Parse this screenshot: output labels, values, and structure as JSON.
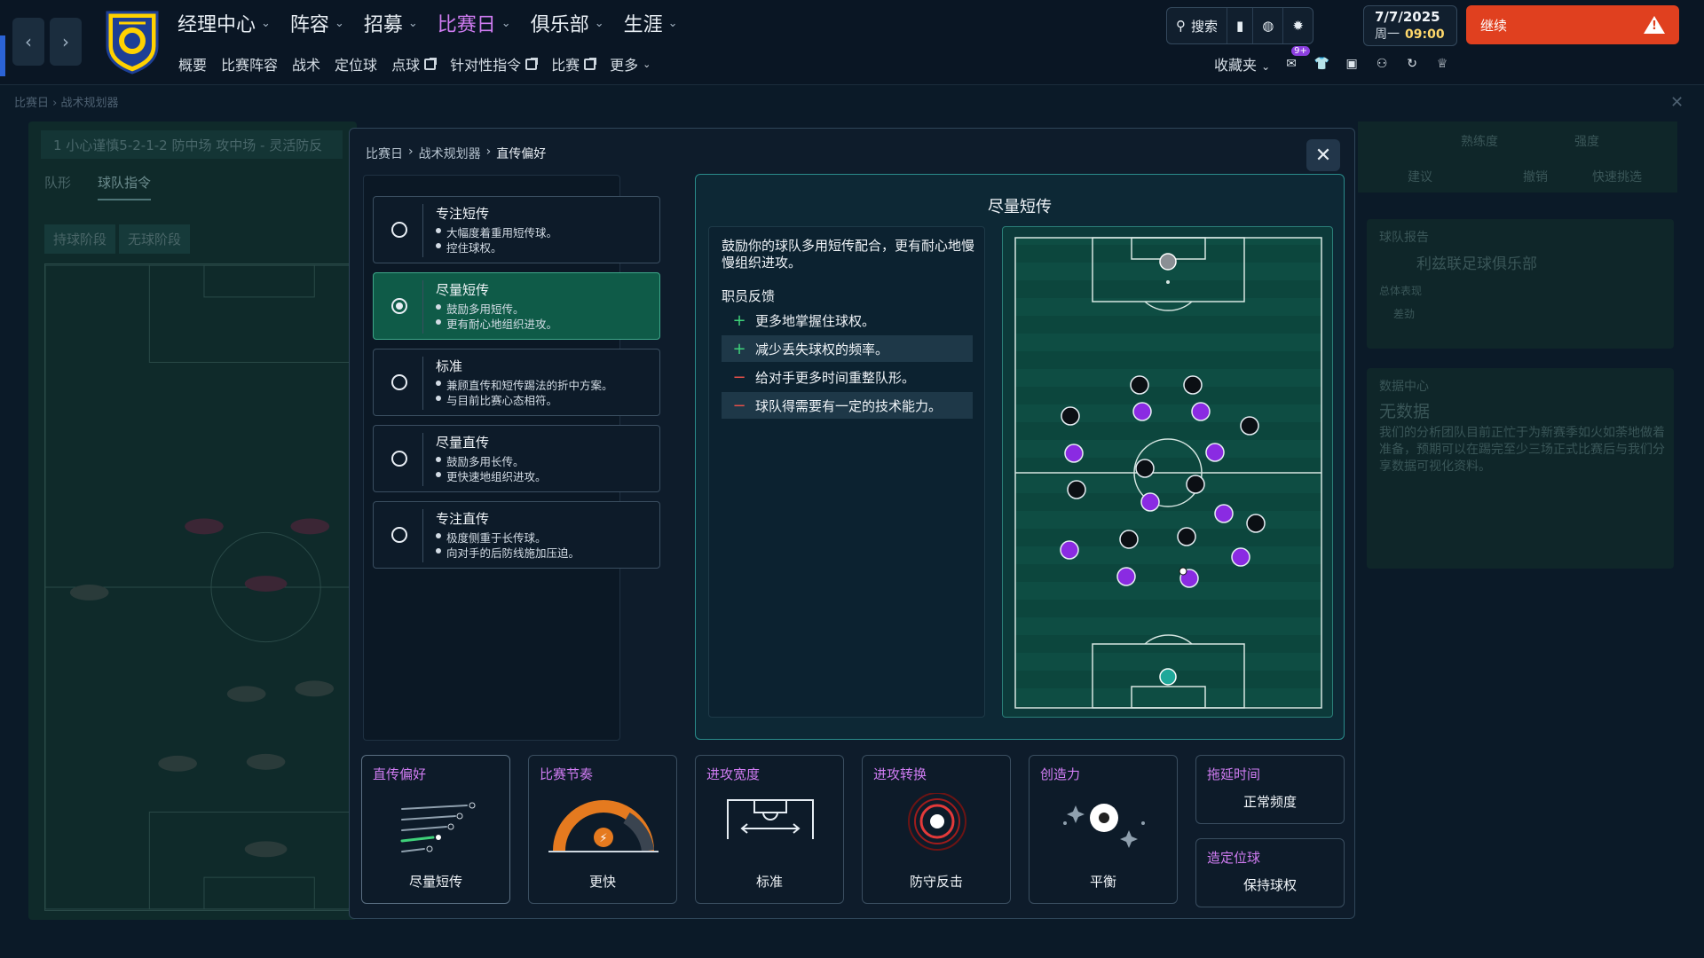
{
  "topbar": {
    "nav": [
      {
        "label": "经理中心",
        "active": false
      },
      {
        "label": "阵容",
        "active": false
      },
      {
        "label": "招募",
        "active": false
      },
      {
        "label": "比赛日",
        "active": true
      },
      {
        "label": "俱乐部",
        "active": false
      },
      {
        "label": "生涯",
        "active": false
      }
    ],
    "subnav": [
      {
        "label": "概要",
        "ext": false
      },
      {
        "label": "比赛阵容",
        "ext": false
      },
      {
        "label": "战术",
        "ext": false
      },
      {
        "label": "定位球",
        "ext": false
      },
      {
        "label": "点球",
        "ext": true
      },
      {
        "label": "针对性指令",
        "ext": true
      },
      {
        "label": "比赛",
        "ext": true
      },
      {
        "label": "更多",
        "ext": false
      }
    ],
    "search_label": "搜索",
    "date": "7/7/2025",
    "weekday": "周一",
    "time": "09:00",
    "continue_label": "继续",
    "favorites_label": "收藏夹",
    "notification_badge": "9+"
  },
  "background": {
    "breadcrumb": [
      "比赛日",
      "战术规划器"
    ],
    "tactic_line": "1 小心谨慎5-2-1-2 防中场 攻中场 - 灵活防反",
    "tabs": [
      "队形",
      "球队指令"
    ],
    "phases": [
      "持球阶段",
      "无球阶段"
    ],
    "right_labels": {
      "familiarity": "熟练度",
      "intensity": "强度",
      "suggest": "建议",
      "undo": "撤销",
      "quick_pick": "快速挑选",
      "team_report": "球队报告",
      "club_name": "利兹联足球俱乐部",
      "overall": "总体表现",
      "poor": "差劲",
      "data_center": "数据中心",
      "no_data": "无数据",
      "no_data_text": "我们的分析团队目前正忙于为新赛季如火如荼地做着准备，预期可以在踢完至少三场正式比赛后与我们分享数据可视化资料。"
    }
  },
  "modal": {
    "breadcrumb": [
      "比赛日",
      "战术规划器",
      "直传偏好"
    ],
    "options": [
      {
        "title": "专注短传",
        "bullets": [
          "大幅度着重用短传球。",
          "控住球权。"
        ],
        "selected": false
      },
      {
        "title": "尽量短传",
        "bullets": [
          "鼓励多用短传。",
          "更有耐心地组织进攻。"
        ],
        "selected": true
      },
      {
        "title": "标准",
        "bullets": [
          "兼顾直传和短传踢法的折中方案。",
          "与目前比赛心态相符。"
        ],
        "selected": false
      },
      {
        "title": "尽量直传",
        "bullets": [
          "鼓励多用长传。",
          "更快速地组织进攻。"
        ],
        "selected": false
      },
      {
        "title": "专注直传",
        "bullets": [
          "极度侧重于长传球。",
          "向对手的后防线施加压迫。"
        ],
        "selected": false
      }
    ],
    "detail": {
      "title": "尽量短传",
      "description": "鼓励你的球队多用短传配合，更有耐心地慢慢组织进攻。",
      "feedback_label": "职员反馈",
      "feedback": [
        {
          "sign": "+",
          "text": "更多地掌握住球权。"
        },
        {
          "sign": "+",
          "text": "减少丢失球权的频率。"
        },
        {
          "sign": "−",
          "text": "给对手更多时间重整队形。"
        },
        {
          "sign": "−",
          "text": "球队得需要有一定的技术能力。"
        }
      ]
    },
    "cards": [
      {
        "title": "直传偏好",
        "value": "尽量短传",
        "icon": "passing-lines-icon"
      },
      {
        "title": "比赛节奏",
        "value": "更快",
        "icon": "tempo-gauge-icon"
      },
      {
        "title": "进攻宽度",
        "value": "标准",
        "icon": "width-goal-icon"
      },
      {
        "title": "进攻转换",
        "value": "防守反击",
        "icon": "target-icon"
      },
      {
        "title": "创造力",
        "value": "平衡",
        "icon": "ball-sparkle-icon"
      },
      {
        "title": "拖延时间",
        "value": "正常频度",
        "icon": "none"
      },
      {
        "title": "造定位球",
        "value": "保持球权",
        "icon": "none"
      }
    ],
    "colors": {
      "accent": "#d07cf2",
      "selected": "#0f5b48",
      "purple_player": "#8a2be2",
      "black_player": "#0b0f14",
      "pitch": "#0c4a40"
    }
  }
}
